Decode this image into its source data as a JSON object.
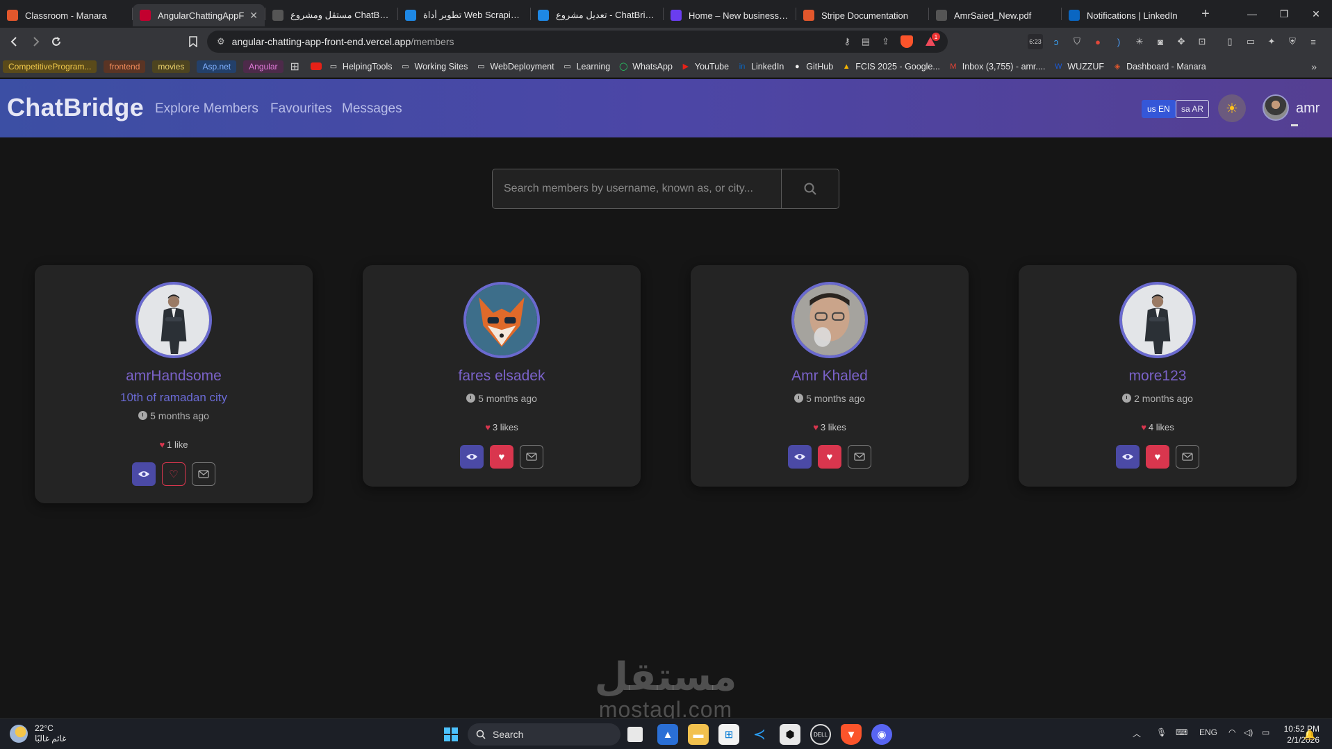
{
  "browser": {
    "tabs": [
      {
        "label": "Classroom - Manara",
        "color": "#e2572c",
        "glyph": "M"
      },
      {
        "label": "AngularChattingAppF",
        "color": "#c3002f",
        "glyph": "A",
        "active": true
      },
      {
        "label": "مستقل ومشروع ChatBridge",
        "color": "#555",
        "glyph": "◎"
      },
      {
        "label": "تطوير أداة Web Scraping ل",
        "color": "#1e88e5",
        "glyph": "●"
      },
      {
        "label": "تعديل مشروع - ChatBridge",
        "color": "#1e88e5",
        "glyph": "●"
      },
      {
        "label": "Home – New business san",
        "color": "#6a3df0",
        "glyph": "■"
      },
      {
        "label": "Stripe Documentation",
        "color": "#e2572c",
        "glyph": "S"
      },
      {
        "label": "AmrSaied_New.pdf",
        "color": "#555",
        "glyph": "◎"
      },
      {
        "label": "Notifications | LinkedIn",
        "color": "#0a66c2",
        "glyph": "in"
      }
    ],
    "new_tab": "+",
    "window": {
      "minimize": "—",
      "restore": "❐",
      "close": "✕"
    },
    "url_host": "angular-chatting-app-front-end.vercel.app",
    "url_path": "/members",
    "ext_badge": "6:23",
    "shield_count": "1",
    "bookmarks_chips": [
      {
        "label": "CompetitiveProgram...",
        "bg": "#5a4a1a",
        "fg": "#f0c84a"
      },
      {
        "label": "frontend",
        "bg": "#5a3424",
        "fg": "#f08a5a"
      },
      {
        "label": "movies",
        "bg": "#4d4420",
        "fg": "#e8cf6a"
      },
      {
        "label": "Asp.net",
        "bg": "#23406a",
        "fg": "#7fb0ff"
      },
      {
        "label": "Angular",
        "bg": "#4d2a4a",
        "fg": "#e07ad8"
      }
    ],
    "bookmarks": [
      {
        "label": "HelpingTools",
        "icon": "folder"
      },
      {
        "label": "Working Sites",
        "icon": "folder"
      },
      {
        "label": "WebDeployment",
        "icon": "folder"
      },
      {
        "label": "Learning",
        "icon": "folder"
      },
      {
        "label": "WhatsApp",
        "icon": "whatsapp"
      },
      {
        "label": "YouTube",
        "icon": "youtube"
      },
      {
        "label": "LinkedIn",
        "icon": "linkedin"
      },
      {
        "label": "GitHub",
        "icon": "github"
      },
      {
        "label": "FCIS 2025 - Google...",
        "icon": "drive"
      },
      {
        "label": "Inbox (3,755) - amr....",
        "icon": "gmail"
      },
      {
        "label": "WUZZUF",
        "icon": "wuzzuf"
      },
      {
        "label": "Dashboard - Manara",
        "icon": "manara"
      }
    ],
    "more": "»"
  },
  "app": {
    "brand": "ChatBridge",
    "nav": [
      "Explore Members",
      "Favourites",
      "Messages"
    ],
    "lang_en": "us EN",
    "lang_ar": "sa AR",
    "theme_icon": "☀",
    "user": "amr"
  },
  "search": {
    "placeholder": "Search members by username, known as, or city..."
  },
  "members": [
    {
      "name": "amrHandsome",
      "city": "10th of ramadan city",
      "time": "5 months ago",
      "likes": "1 like",
      "favourite": false,
      "avatar": "suit"
    },
    {
      "name": "fares elsadek",
      "city": "",
      "time": "5 months ago",
      "likes": "3 likes",
      "favourite": true,
      "avatar": "fox"
    },
    {
      "name": "Amr Khaled",
      "city": "",
      "time": "5 months ago",
      "likes": "3 likes",
      "favourite": true,
      "avatar": "selfie"
    },
    {
      "name": "more123",
      "city": "",
      "time": "2 months ago",
      "likes": "4 likes",
      "favourite": true,
      "avatar": "suit"
    }
  ],
  "watermark": {
    "ar": "مستقل",
    "en": "mostaql.com"
  },
  "taskbar": {
    "temp": "22°C",
    "weather_desc": "غائم غالبًا",
    "search": "Search",
    "lang": "ENG",
    "time": "10:52 PM",
    "date": "2/1/2026"
  }
}
